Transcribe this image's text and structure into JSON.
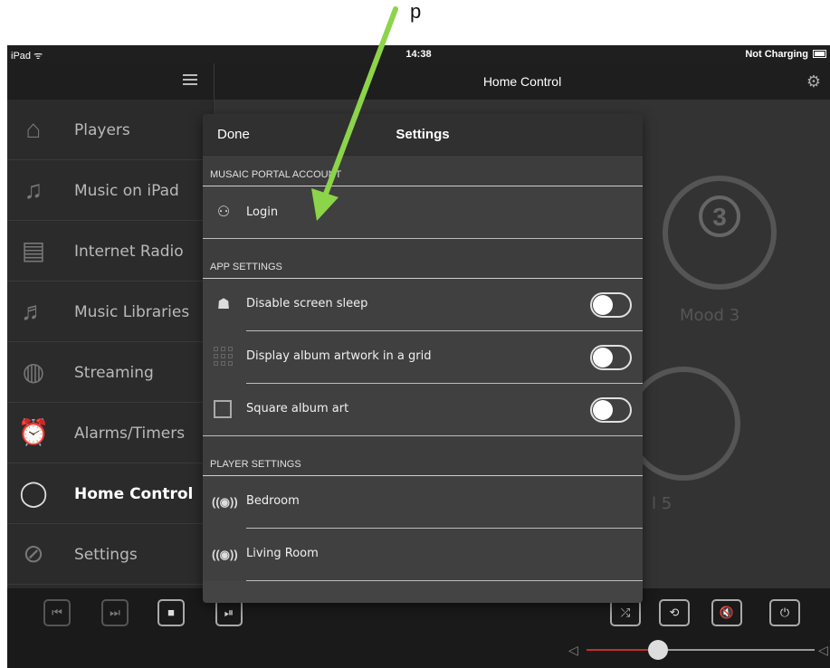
{
  "caption": {
    "text": "p"
  },
  "status_bar": {
    "device": "iPad ᯤ",
    "time": "14:38",
    "battery": "Not Charging"
  },
  "nav_bar": {
    "title": "Home Control"
  },
  "sidebar": {
    "items": [
      {
        "label": "Players",
        "icon": "house-icon"
      },
      {
        "label": "Music on iPad",
        "icon": "music-note-icon"
      },
      {
        "label": "Internet Radio",
        "icon": "radio-icon"
      },
      {
        "label": "Music Libraries",
        "icon": "music-library-icon"
      },
      {
        "label": "Streaming",
        "icon": "globe-icon"
      },
      {
        "label": "Alarms/Timers",
        "icon": "alarm-clock-icon"
      },
      {
        "label": "Home Control",
        "icon": "lightbulb-icon",
        "active": true
      },
      {
        "label": "Settings",
        "icon": "wrench-icon"
      }
    ]
  },
  "main": {
    "mood3": {
      "number": "3",
      "label": "Mood 3"
    },
    "mood5": {
      "label": "l 5"
    }
  },
  "modal": {
    "done": "Done",
    "title": "Settings",
    "sections": {
      "account": {
        "header": "MUSAIC PORTAL ACCOUNT",
        "login": "Login"
      },
      "app": {
        "header": "APP SETTINGS",
        "disable_sleep": "Disable screen sleep",
        "grid": "Display album artwork in a grid",
        "square": "Square album art"
      },
      "player": {
        "header": "PLAYER SETTINGS",
        "bedroom": "Bedroom",
        "living": "Living Room"
      }
    }
  },
  "colors": {
    "arrow": "#8cd44a",
    "slider_active": "#c0302c"
  }
}
